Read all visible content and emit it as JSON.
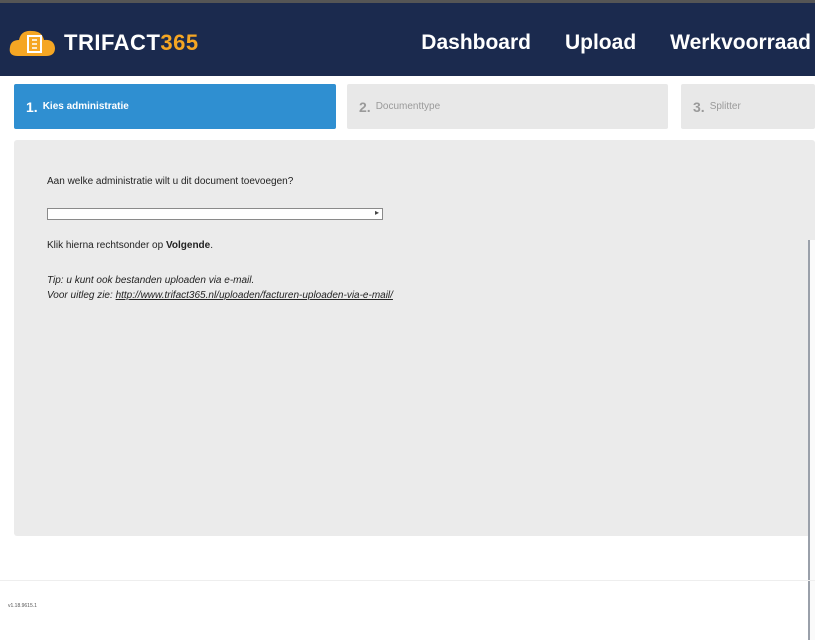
{
  "header": {
    "logo_text_white": "TRIFACT",
    "logo_text_orange": "365",
    "colors": {
      "bar": "#1b2a4e",
      "accent": "#f5a623"
    },
    "nav": [
      {
        "label": "Dashboard"
      },
      {
        "label": "Upload"
      },
      {
        "label": "Werkvoorraad"
      }
    ]
  },
  "steps": [
    {
      "number": "1.",
      "label": "Kies administratie",
      "active": true
    },
    {
      "number": "2.",
      "label": "Documenttype",
      "active": false
    },
    {
      "number": "3.",
      "label": "Splitter",
      "active": false
    }
  ],
  "form": {
    "question": "Aan welke administratie wilt u dit document toevoegen?",
    "select_value": "",
    "hint_prefix": "Klik hierna rechtsonder op ",
    "hint_bold": "Volgende",
    "hint_suffix": ".",
    "tip_line1": "Tip: u kunt ook bestanden uploaden via e-mail.",
    "tip_line2_prefix": "Voor uitleg zie: ",
    "tip_link": "http://www.trifact365.nl/uploaden/facturen-uploaden-via-e-mail/"
  },
  "footer": {
    "version": "v1.18.9615.1"
  }
}
